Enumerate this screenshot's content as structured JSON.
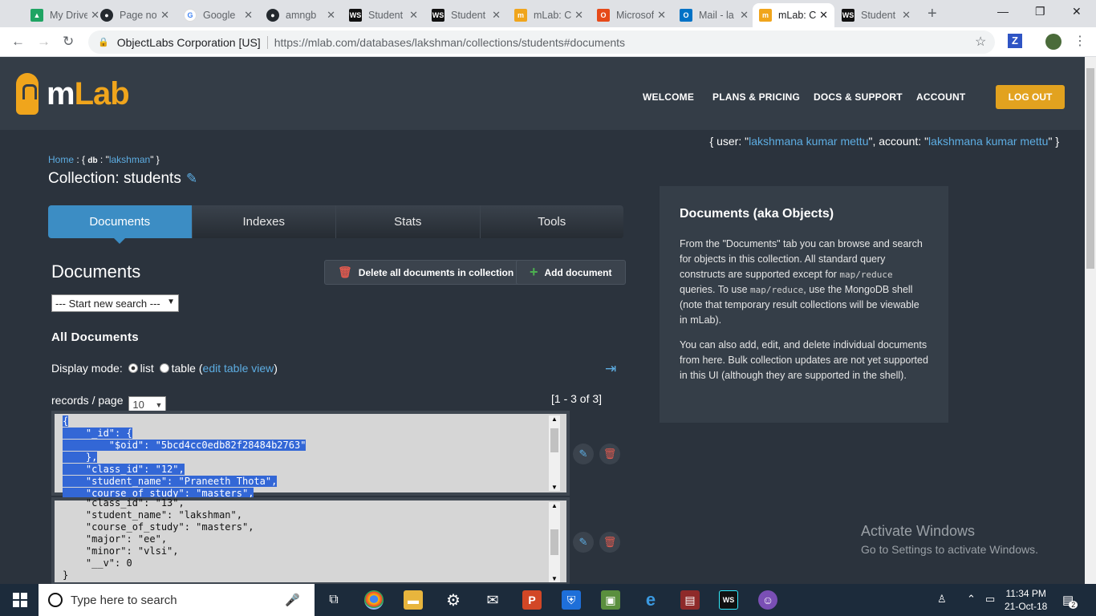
{
  "browser": {
    "tabs": [
      {
        "label": "My Drive",
        "icon": "google-drive-icon",
        "color": "#1fa463"
      },
      {
        "label": "Page not",
        "icon": "github-icon",
        "color": "#24292e"
      },
      {
        "label": "Google",
        "icon": "google-icon",
        "color": "#4285f4"
      },
      {
        "label": "amngb",
        "icon": "github-icon",
        "color": "#24292e"
      },
      {
        "label": "Student",
        "icon": "webstorm-icon",
        "color": "#111111"
      },
      {
        "label": "Student",
        "icon": "webstorm-icon",
        "color": "#111111"
      },
      {
        "label": "mLab: C",
        "icon": "mlab-icon",
        "color": "#f0a51c"
      },
      {
        "label": "Microsof",
        "icon": "office-icon",
        "color": "#e64a19"
      },
      {
        "label": "Mail - la",
        "icon": "outlook-icon",
        "color": "#0072c6"
      },
      {
        "label": "mLab: C",
        "icon": "mlab-icon",
        "color": "#f0a51c"
      },
      {
        "label": "Student",
        "icon": "webstorm-icon",
        "color": "#111111"
      }
    ],
    "active_tab": 9,
    "new_tab": "+",
    "org": "ObjectLabs Corporation [US]",
    "url": "https://mlab.com/databases/lakshman/collections/students#documents",
    "ext_label": "Z"
  },
  "header": {
    "logo_m": "m",
    "logo_lab": "Lab",
    "nav": [
      "WELCOME",
      "PLANS & PRICING",
      "DOCS & SUPPORT",
      "ACCOUNT"
    ],
    "logout": "LOG OUT"
  },
  "user": {
    "prefix": "{ user: \"",
    "user_name": "lakshmana kumar mettu",
    "middle": "\", account: \"",
    "account_name": "lakshmana kumar mettu",
    "suffix": "\" }"
  },
  "breadcrumb": {
    "home": "Home",
    "sep": " : { ",
    "db_key": "db",
    "db_mid": " : \"",
    "db_name": "lakshman",
    "end": "\" }"
  },
  "collection": {
    "label": "Collection: students"
  },
  "tabs": [
    "Documents",
    "Indexes",
    "Stats",
    "Tools"
  ],
  "documents": {
    "heading": "Documents",
    "delete_all": "Delete all documents in collection",
    "add": "Add document",
    "search_select": "--- Start new search ---",
    "all_docs": "All Documents",
    "display_mode_label": "Display mode:",
    "mode_list": "list",
    "mode_table": "table (",
    "edit_table_view": "edit table view",
    "mode_close": ")",
    "records_label": "records / page",
    "records_value": "10",
    "range": "[1 - 3 of 3]",
    "doc1_lines": [
      "{",
      "    \"_id\": {",
      "        \"$oid\": \"5bcd4cc0edb82f28484b2763\"",
      "    },",
      "    \"class_id\": \"12\",",
      "    \"student_name\": \"Praneeth Thota\",",
      "    \"course_of_study\": \"masters\","
    ],
    "doc2_lines": [
      "    \"class_id\": \"13\",",
      "    \"student_name\": \"lakshman\",",
      "    \"course_of_study\": \"masters\",",
      "    \"major\": \"ee\",",
      "    \"minor\": \"vlsi\",",
      "    \"__v\": 0",
      "}"
    ]
  },
  "help": {
    "title": "Documents (aka Objects)",
    "p1a": "From the \"Documents\" tab you can browse and search for objects in this collection. All standard query constructs are supported except for ",
    "p1code1": "map/reduce",
    "p1b": " queries. To use ",
    "p1code2": "map/reduce",
    "p1c": ", use the MongoDB shell (note that temporary result collections will be viewable in mLab).",
    "p2": "You can also add, edit, and delete individual documents from here. Bulk collection updates are not yet supported in this UI (although they are supported in the shell)."
  },
  "watermark": {
    "line1": "Activate Windows",
    "line2": "Go to Settings to activate Windows."
  },
  "taskbar": {
    "search_placeholder": "Type here to search",
    "time": "11:34 PM",
    "date": "21-Oct-18",
    "notifications": "2"
  },
  "colors": {
    "accent": "#3c8dc4",
    "logout": "#e2a21f",
    "brand_orange": "#f0a51c",
    "selection": "#3367d6",
    "delete_red": "#e05a4f",
    "add_green": "#4caf50"
  }
}
